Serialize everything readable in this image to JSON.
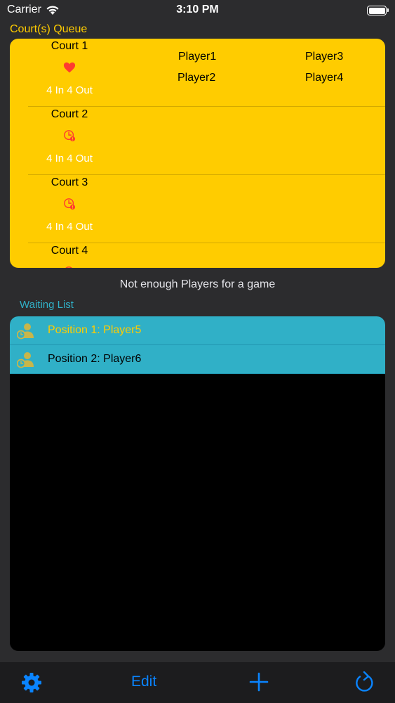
{
  "status_bar": {
    "carrier": "Carrier",
    "time": "3:10 PM"
  },
  "courts_section": {
    "title": "Court(s) Queue"
  },
  "courts": [
    {
      "name": "Court 1",
      "icon": "heart-icon",
      "rule": "4 In 4 Out",
      "players": [
        "Player1",
        "Player3",
        "Player2",
        "Player4"
      ]
    },
    {
      "name": "Court 2",
      "icon": "clock-alert-icon",
      "rule": "4 In 4 Out",
      "players": []
    },
    {
      "name": "Court 3",
      "icon": "clock-alert-icon",
      "rule": "4 In 4 Out",
      "players": []
    },
    {
      "name": "Court 4",
      "icon": "clock-alert-icon",
      "rule": "",
      "players": []
    }
  ],
  "message": "Not enough Players for a game",
  "waiting_section": {
    "title": "Waiting List"
  },
  "waiting_list": [
    {
      "label": "Position 1: Player5",
      "color": "#ffcc00"
    },
    {
      "label": "Position 2: Player6",
      "color": "#000000"
    }
  ],
  "tab_bar": {
    "edit_label": "Edit"
  },
  "colors": {
    "accent": "#0a84ff",
    "courts_bg": "#ffcc00",
    "waiting_bg": "#30b0c7",
    "alert": "#ff3b30"
  }
}
